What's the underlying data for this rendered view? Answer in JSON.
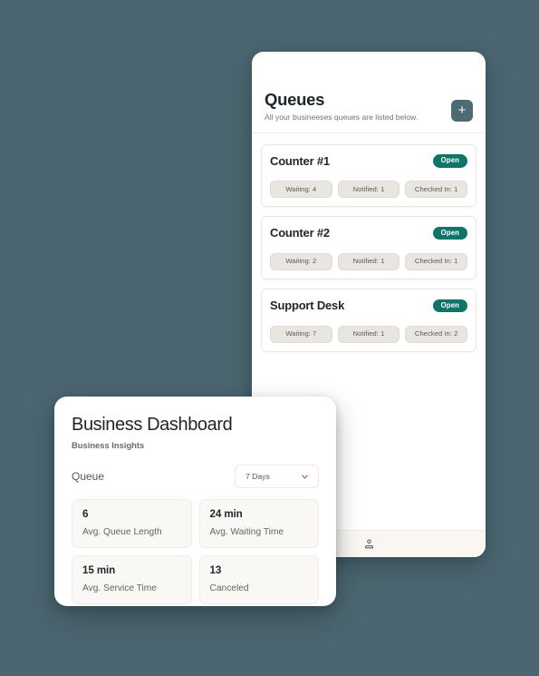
{
  "theme": {
    "page_background": "#4b6670",
    "accent_teal": "#0e7568",
    "slate_button": "#4e6a75",
    "chip_background": "#e9e5e0",
    "card_background": "#ffffff",
    "nav_background": "#faf7f3"
  },
  "phone": {
    "header": {
      "title": "Queues",
      "subtitle": "All your busineeses queues are listed below.",
      "add_button_label": "+",
      "add_button_icon": "plus-icon"
    },
    "queues": [
      {
        "name": "Counter #1",
        "status": "Open",
        "chips": [
          "Waiting: 4",
          "Notified: 1",
          "Checked In: 1"
        ]
      },
      {
        "name": "Counter #2",
        "status": "Open",
        "chips": [
          "Waiting: 2",
          "Notified: 1",
          "Checked In: 1"
        ]
      },
      {
        "name": "Support Desk",
        "status": "Open",
        "chips": [
          "Waiting: 7",
          "Notified: 1",
          "Checked In: 2"
        ]
      }
    ],
    "bottom_nav": {
      "items": [
        {
          "icon": "person-icon",
          "label": ""
        }
      ]
    }
  },
  "dashboard": {
    "title": "Business Dashboard",
    "subtitle": "Business Insights",
    "filter_label": "Queue",
    "range_select": {
      "value": "7 Days",
      "icon": "chevron-down-icon"
    },
    "stats": [
      {
        "value": "6",
        "label": "Avg. Queue Length"
      },
      {
        "value": "24 min",
        "label": "Avg. Waiting Time"
      },
      {
        "value": "15 min",
        "label": "Avg. Service Time"
      },
      {
        "value": "13",
        "label": "Canceled"
      }
    ]
  }
}
